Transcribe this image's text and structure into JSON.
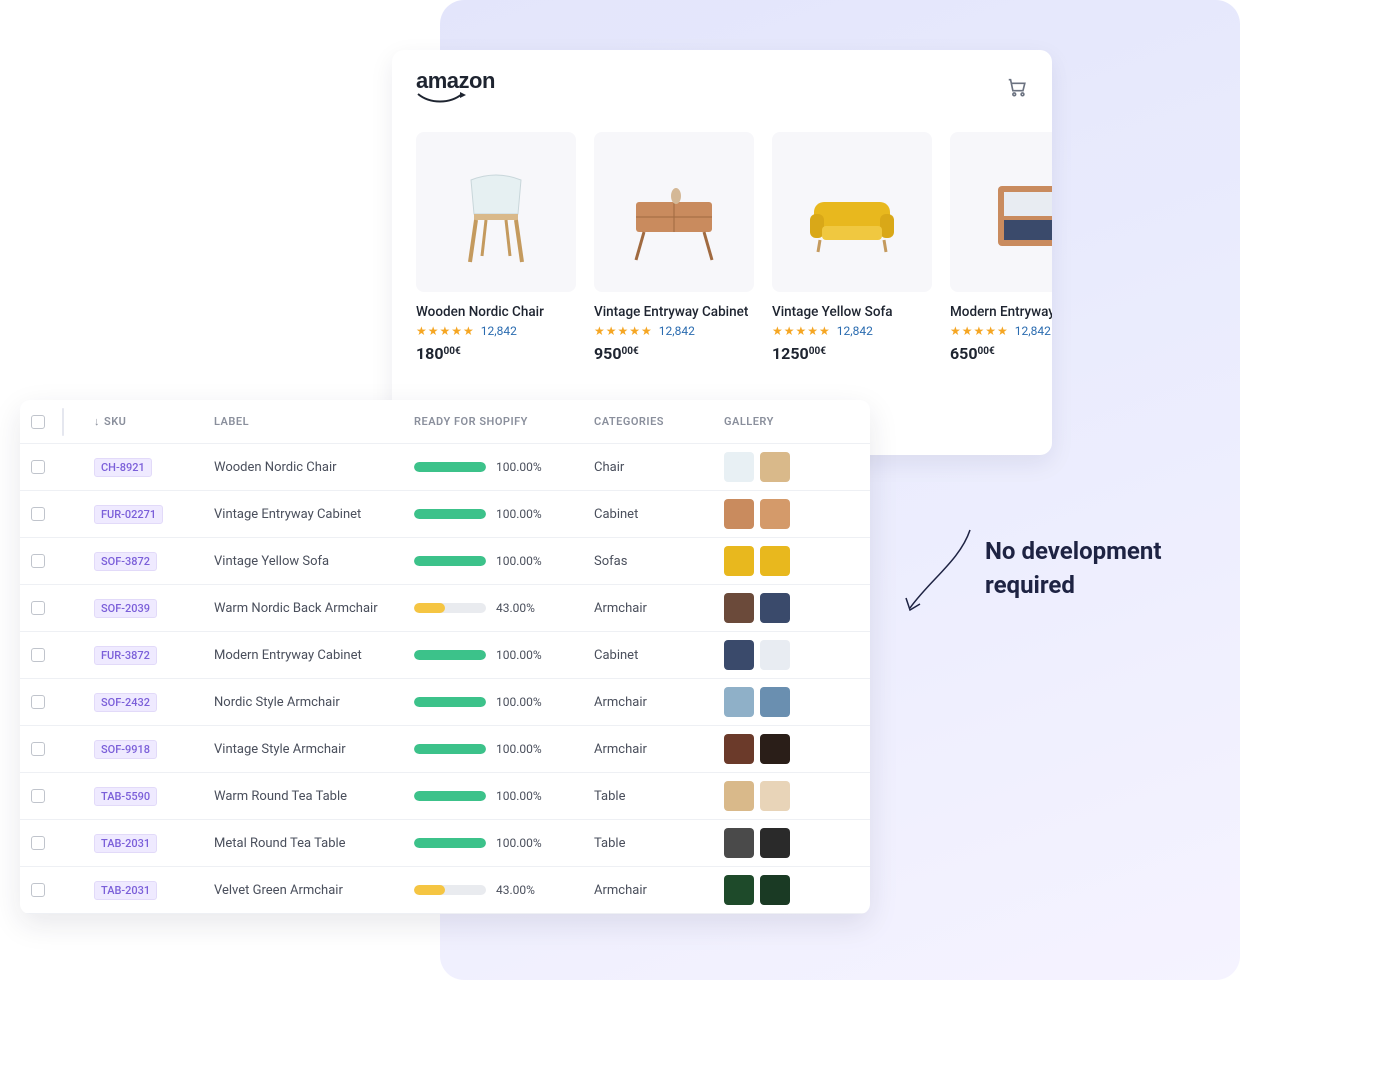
{
  "storefront": {
    "brand": "amazon",
    "products": [
      {
        "name": "Wooden Nordic Chair",
        "reviews": "12,842",
        "price_main": "180",
        "price_cents": "00",
        "currency": "€"
      },
      {
        "name": "Vintage Entryway Cabinet",
        "reviews": "12,842",
        "price_main": "950",
        "price_cents": "00",
        "currency": "€"
      },
      {
        "name": "Vintage Yellow Sofa",
        "reviews": "12,842",
        "price_main": "1250",
        "price_cents": "00",
        "currency": "€"
      },
      {
        "name": "Modern Entryway",
        "reviews": "12,842",
        "price_main": "650",
        "price_cents": "00",
        "currency": "€"
      }
    ]
  },
  "callout": {
    "line1": "No development",
    "line2": "required"
  },
  "table": {
    "headers": {
      "sku": "SKU",
      "label": "LABEL",
      "ready": "READY FOR SHOPIFY",
      "categories": "CATEGORIES",
      "gallery": "GALLERY"
    },
    "rows": [
      {
        "sku": "CH-8921",
        "label": "Wooden Nordic Chair",
        "pct": "100.00%",
        "pct_val": 100,
        "color": "green",
        "category": "Chair",
        "thumbs": [
          "chair-light",
          "chair-wood"
        ]
      },
      {
        "sku": "FUR-02271",
        "label": "Vintage Entryway Cabinet",
        "pct": "100.00%",
        "pct_val": 100,
        "color": "green",
        "category": "Cabinet",
        "thumbs": [
          "cabinet-a",
          "cabinet-b"
        ]
      },
      {
        "sku": "SOF-3872",
        "label": "Vintage Yellow Sofa",
        "pct": "100.00%",
        "pct_val": 100,
        "color": "green",
        "category": "Sofas",
        "thumbs": [
          "sofa-a",
          "sofa-b"
        ]
      },
      {
        "sku": "SOF-2039",
        "label": "Warm Nordic Back Armchair",
        "pct": "43.00%",
        "pct_val": 43,
        "color": "yellow",
        "category": "Armchair",
        "thumbs": [
          "arm-a",
          "arm-b"
        ]
      },
      {
        "sku": "FUR-3872",
        "label": "Modern Entryway Cabinet",
        "pct": "100.00%",
        "pct_val": 100,
        "color": "green",
        "category": "Cabinet",
        "thumbs": [
          "mod-a",
          "mod-b"
        ]
      },
      {
        "sku": "SOF-2432",
        "label": "Nordic Style Armchair",
        "pct": "100.00%",
        "pct_val": 100,
        "color": "green",
        "category": "Armchair",
        "thumbs": [
          "nord-a",
          "nord-b"
        ]
      },
      {
        "sku": "SOF-9918",
        "label": "Vintage Style Armchair",
        "pct": "100.00%",
        "pct_val": 100,
        "color": "green",
        "category": "Armchair",
        "thumbs": [
          "vin-a",
          "vin-b"
        ]
      },
      {
        "sku": "TAB-5590",
        "label": "Warm Round Tea Table",
        "pct": "100.00%",
        "pct_val": 100,
        "color": "green",
        "category": "Table",
        "thumbs": [
          "tab-a",
          "tab-b"
        ]
      },
      {
        "sku": "TAB-2031",
        "label": "Metal Round Tea Table",
        "pct": "100.00%",
        "pct_val": 100,
        "color": "green",
        "category": "Table",
        "thumbs": [
          "met-a",
          "met-b"
        ]
      },
      {
        "sku": "TAB-2031",
        "label": "Velvet Green Armchair",
        "pct": "43.00%",
        "pct_val": 43,
        "color": "yellow",
        "category": "Armchair",
        "thumbs": [
          "vel-a",
          "vel-b"
        ]
      }
    ]
  },
  "thumb_colors": {
    "chair-light": "#e8f0f4",
    "chair-wood": "#d9b98a",
    "cabinet-a": "#c98b5e",
    "cabinet-b": "#d49a6a",
    "sofa-a": "#e8b81e",
    "sofa-b": "#e8b81e",
    "arm-a": "#6b4a3a",
    "arm-b": "#3a4a6b",
    "mod-a": "#3a4a6b",
    "mod-b": "#e8ecf2",
    "nord-a": "#8fb0c8",
    "nord-b": "#6a8fb0",
    "vin-a": "#6b3a2a",
    "vin-b": "#2a1e18",
    "tab-a": "#d9b98a",
    "tab-b": "#e8d4b8",
    "met-a": "#4a4a4a",
    "met-b": "#2a2a2a",
    "vel-a": "#1e4a2a",
    "vel-b": "#1a3a24"
  }
}
